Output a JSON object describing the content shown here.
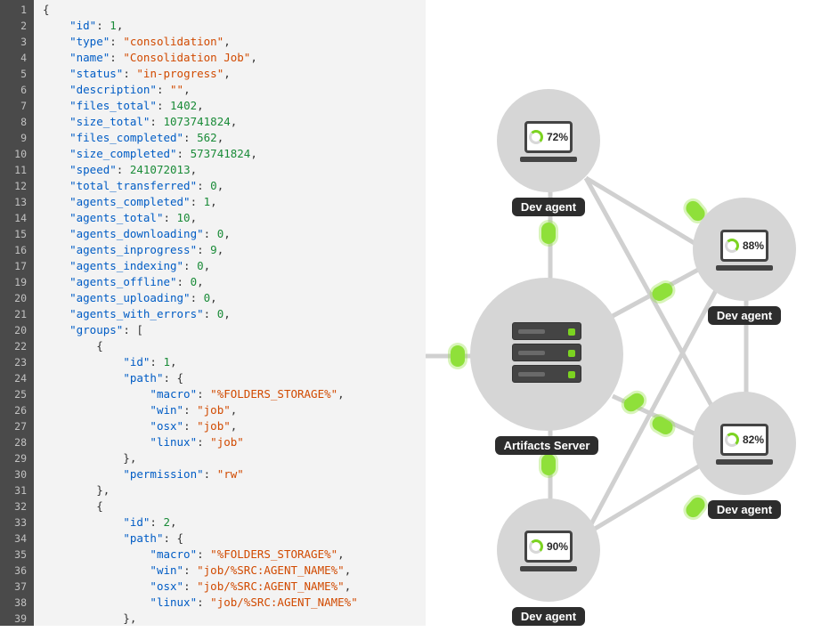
{
  "code": {
    "lines": [
      1,
      2,
      3,
      4,
      5,
      6,
      7,
      8,
      9,
      10,
      11,
      12,
      13,
      14,
      15,
      16,
      17,
      19,
      20,
      21,
      20,
      22,
      23,
      24,
      25,
      26,
      27,
      28,
      29,
      30,
      31,
      32,
      33,
      34,
      35,
      36,
      37,
      38,
      39
    ],
    "json_display": {
      "id": 1,
      "type": "consolidation",
      "name": "Consolidation Job",
      "status": "in-progress",
      "description": "",
      "files_total": 1402,
      "size_total": 1073741824,
      "files_completed": 562,
      "size_completed": 573741824,
      "speed": 241072013,
      "total_transferred": 0,
      "agents_completed": 1,
      "agents_total": 10,
      "agents_downloading": 0,
      "agents_inprogress": 9,
      "agents_indexing": 0,
      "agents_offline": 0,
      "agents_uploading": 0,
      "agents_with_errors": 0,
      "groups": [
        {
          "id": 1,
          "path": {
            "macro": "%FOLDERS_STORAGE%",
            "win": "job",
            "osx": "job",
            "linux": "job"
          },
          "permission": "rw"
        },
        {
          "id": 2,
          "path": {
            "macro": "%FOLDERS_STORAGE%",
            "win": "job/%SRC:AGENT_NAME%",
            "osx": "job/%SRC:AGENT_NAME%",
            "linux": "job/%SRC:AGENT_NAME%"
          }
        }
      ]
    }
  },
  "diagram": {
    "server_label": "Artifacts Server",
    "agents": [
      {
        "label": "Dev agent",
        "percent": "72%"
      },
      {
        "label": "Dev agent",
        "percent": "88%"
      },
      {
        "label": "Dev agent",
        "percent": "82%"
      },
      {
        "label": "Dev agent",
        "percent": "90%"
      }
    ]
  }
}
